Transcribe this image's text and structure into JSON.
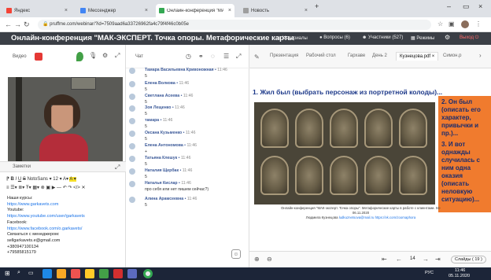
{
  "browser": {
    "tabs": [
      {
        "label": "Яндекс",
        "color": "#f44336"
      },
      {
        "label": "Мессенджер",
        "color": "#4285f4"
      },
      {
        "label": "Онлайн-конференция \"МАК-экспер\"",
        "color": "#34a853"
      },
      {
        "label": "Новость",
        "color": "#9e9e9e"
      }
    ],
    "url": "pruffme.com/webinar/?id=7509aad6a33726962fa4c79f4f46c0b05e"
  },
  "app": {
    "title": "Онлайн-конференция \"МАК-ЭКСПЕРТ. Точка опоры. Метафорические карты",
    "menu": {
      "materials": "Материалы",
      "questions": "Вопросы (6)",
      "participants": "Участники (527)",
      "modes": "Режимы",
      "exit": "Выход"
    }
  },
  "video_panel": {
    "label": "Видео"
  },
  "notes": {
    "title": "Заметки",
    "font": "NotoSans",
    "size": "12",
    "lines": [
      "Наши курсы:",
      "https://www.garkavets.com",
      "Youtube:",
      "https://www.youtube.com/user/garkavets",
      "Facebook:",
      "https://www.facebook.com/o.garkavets/",
      "Связаться с менеджером:",
      "sellgarkavets.e@gmail.com",
      "+380947100134",
      "+79585815179"
    ]
  },
  "chat": {
    "title": "Чат",
    "messages": [
      {
        "name": "Тамара Васильевна Кривоножная",
        "time": "11:46",
        "text": "5"
      },
      {
        "name": "Елена Волкова",
        "time": "11:46",
        "text": "5"
      },
      {
        "name": "Светлана Асеева",
        "time": "11:46",
        "text": "5"
      },
      {
        "name": "Зоя Лещенко",
        "time": "11:46",
        "text": "5"
      },
      {
        "name": "тамара",
        "time": "11:46",
        "text": "5"
      },
      {
        "name": "Оксана Кузьменко",
        "time": "11:46",
        "text": "5"
      },
      {
        "name": "Елена Антономова",
        "time": "11:46",
        "text": "+"
      },
      {
        "name": "Татьяна Клешук",
        "time": "11:46",
        "text": "5"
      },
      {
        "name": "Наталия Щербак",
        "time": "11:46",
        "text": "5"
      },
      {
        "name": "Наталья Кислар",
        "time": "11:46",
        "text": "про себя или нет пишем сейчас?)"
      },
      {
        "name": "Алина Арамсеевна",
        "time": "11:46",
        "text": "5"
      }
    ]
  },
  "presentation": {
    "tabs": [
      "Презентация",
      "Рабочий стол",
      "Гархаве",
      "День 2",
      "Кузнецова.pdf",
      "Симон.p"
    ],
    "slide": {
      "q1": "1. Жил был (выбрать персонаж из портретной колоды)...",
      "q2": "2. Он был (описать его характер, привычки и пр.)...",
      "q3": "3. И вот однажды случилась с ним одна оказия (описать неловкую ситуацию)...",
      "caption": "Онлайн-конференция \"МАК-эксперт. Точка опоры\". Метафорические карты в работе с клиентами. 04-06.11.2020",
      "caption2": "Людмила Кузнецова",
      "caption_link1": "ludkuznetsova@mail.ru",
      "caption_link2": "https://vk.com/zoomaphora"
    },
    "page": "14",
    "slides_label": "Слайды",
    "slides_count": "19"
  },
  "taskbar": {
    "time": "11:46",
    "date": "05.11.2020",
    "lang": "РУС"
  }
}
